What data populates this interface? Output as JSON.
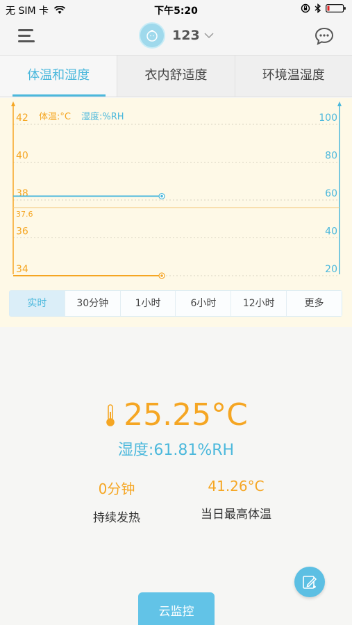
{
  "status_bar": {
    "carrier": "无 SIM 卡",
    "time": "下午5:20"
  },
  "nav": {
    "device_name": "123"
  },
  "tabs": [
    {
      "label": "体温和湿度",
      "active": true
    },
    {
      "label": "衣内舒适度",
      "active": false
    },
    {
      "label": "环境温湿度",
      "active": false
    }
  ],
  "chart_data": {
    "type": "line",
    "legend": {
      "temp": "体温:°C",
      "humidity": "湿度:%RH"
    },
    "y_left": {
      "ticks": [
        "42",
        "40",
        "38",
        "36",
        "34"
      ],
      "range": [
        34,
        42
      ],
      "unit": "°C"
    },
    "y_right": {
      "ticks": [
        "100",
        "80",
        "60",
        "40",
        "20"
      ],
      "range": [
        20,
        100
      ],
      "unit": "%RH"
    },
    "reference_line": {
      "value": 37.6,
      "label": "37.6"
    },
    "series": [
      {
        "name": "体温:°C",
        "axis": "left",
        "values": [
          34,
          34
        ]
      },
      {
        "name": "湿度:%RH",
        "axis": "right",
        "values": [
          62,
          62
        ]
      }
    ],
    "grid": true,
    "colors": {
      "temp": "#f5a623",
      "humidity": "#4bb8dc"
    }
  },
  "ranges": [
    {
      "label": "实时",
      "active": true
    },
    {
      "label": "30分钟",
      "active": false
    },
    {
      "label": "1小时",
      "active": false
    },
    {
      "label": "6小时",
      "active": false
    },
    {
      "label": "12小时",
      "active": false
    },
    {
      "label": "更多",
      "active": false
    }
  ],
  "reading": {
    "temperature": "25.25°C",
    "humidity": "湿度:61.81%RH"
  },
  "stats": [
    {
      "value": "0分钟",
      "label": "持续发热"
    },
    {
      "value": "41.26°C",
      "label": "当日最高体温"
    }
  ],
  "cloud_button": "云监控",
  "colors": {
    "accent_blue": "#4bb8dc",
    "accent_orange": "#f5a623"
  }
}
